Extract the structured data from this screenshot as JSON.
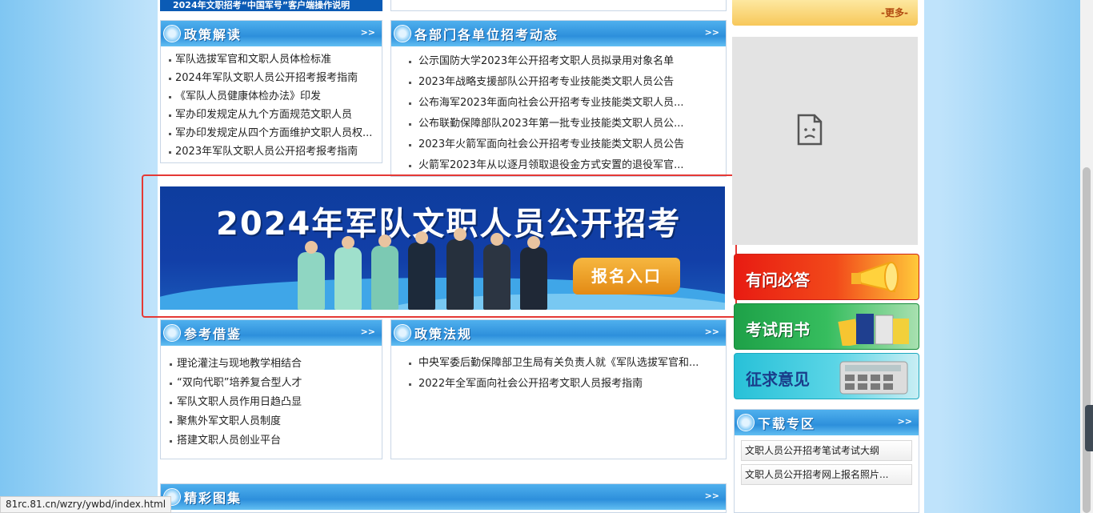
{
  "top": {
    "left_strip_text": "2024年文职招考“中国军号”客户端操作说明",
    "more_label": "-更多-"
  },
  "policy_read": {
    "title": "政策解读",
    "more": ">>",
    "items": [
      "军队选拔军官和文职人员体检标准",
      "2024年军队文职人员公开招考报考指南",
      "《军队人员健康体检办法》印发",
      "军办印发规定从九个方面规范文职人员",
      "军办印发规定从四个方面维护文职人员权...",
      "2023年军队文职人员公开招考报考指南"
    ]
  },
  "dept_news": {
    "title": "各部门各单位招考动态",
    "more": ">>",
    "items": [
      "公示国防大学2023年公开招考文职人员拟录用对象名单",
      "2023年战略支援部队公开招考专业技能类文职人员公告",
      "公布海军2023年面向社会公开招考专业技能类文职人员...",
      "公布联勤保障部队2023年第一批专业技能类文职人员公...",
      "2023年火箭军面向社会公开招考专业技能类文职人员公告",
      "火箭军2023年从以逐月领取退役金方式安置的退役军官..."
    ]
  },
  "banner": {
    "title": "2024年军队文职人员公开招考",
    "button": "报名入口"
  },
  "reference": {
    "title": "参考借鉴",
    "more": ">>",
    "items": [
      "理论灌注与现地教学相结合",
      "“双向代职”培养复合型人才",
      "军队文职人员作用日趋凸显",
      "聚焦外军文职人员制度",
      "搭建文职人员创业平台"
    ]
  },
  "regulations": {
    "title": "政策法规",
    "more": ">>",
    "items": [
      "中央军委后勤保障部卫生局有关负责人就《军队选拔军官和...",
      "2022年全军面向社会公开招考文职人员报考指南"
    ]
  },
  "side_buttons": {
    "ask": "有问必答",
    "books": "考试用书",
    "opinion": "征求意见"
  },
  "downloads": {
    "title": "下载专区",
    "more": ">>",
    "items": [
      "文职人员公开招考笔试考试大纲",
      "文职人员公开招考网上报名照片..."
    ]
  },
  "gallery": {
    "title": "精彩图集",
    "more": ">>"
  },
  "status_url": "81rc.81.cn/wzry/ywbd/index.html",
  "colors": {
    "header_blue": "#2d8fdb",
    "banner_blue": "#123fa8",
    "highlight_red": "#e53935",
    "button_orange": "#e38a14"
  }
}
